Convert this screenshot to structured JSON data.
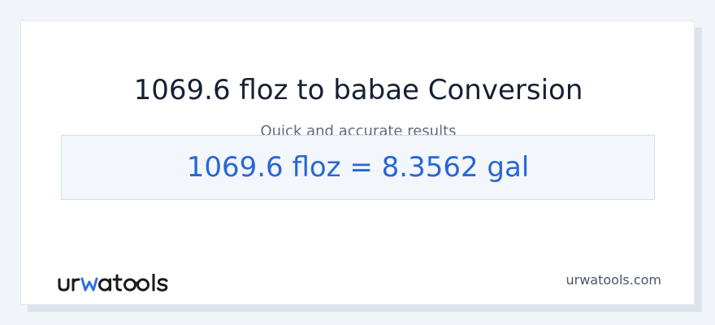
{
  "page": {
    "title": "1069.6 floz to babae Conversion",
    "subtitle": "Quick and accurate results",
    "result": "1069.6 floz = 8.3562 gal",
    "logo_text": "urwatools",
    "site": "urwatools.com"
  },
  "colors": {
    "title": "#162033",
    "subtitle": "#5f6b7c",
    "result": "#2767d6",
    "logo_dark": "#1a1a1a",
    "logo_accent": "#2f6fe4",
    "site": "#4a5568"
  },
  "icons": [
    "urwatools-logo"
  ]
}
